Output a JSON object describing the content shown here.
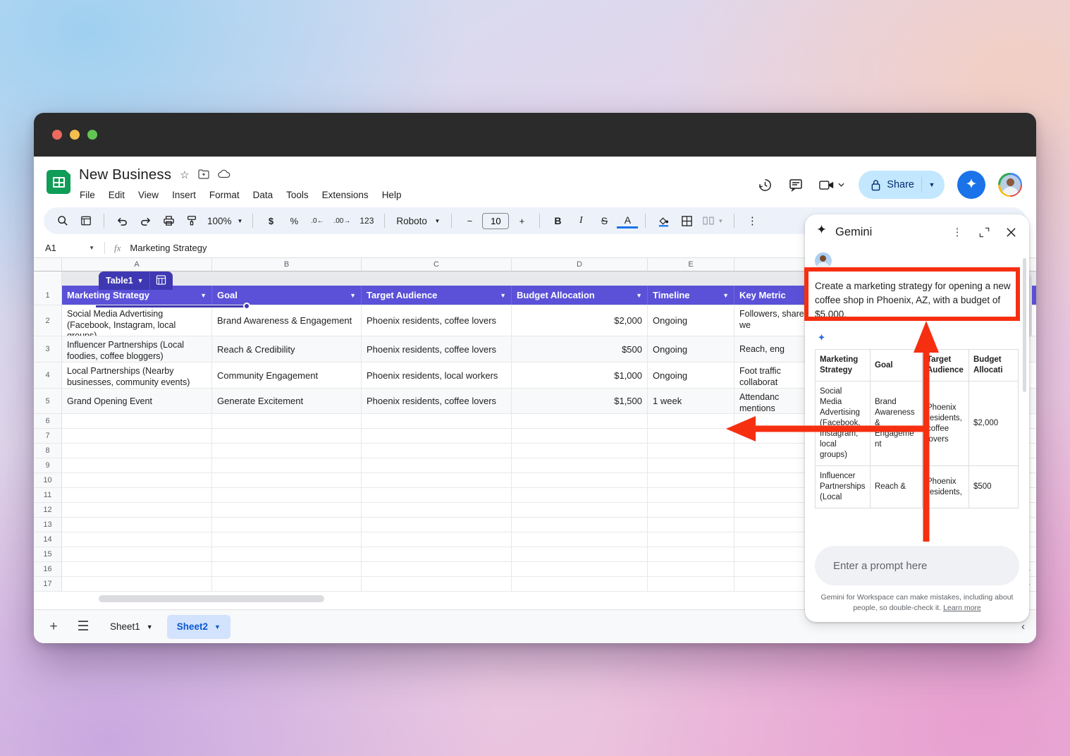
{
  "window": {
    "traffic_lights": [
      "close",
      "minimize",
      "maximize"
    ]
  },
  "header": {
    "doc_title": "New Business",
    "title_icons": [
      "star-icon",
      "move-to-folder-icon",
      "cloud-saved-icon"
    ],
    "menus": [
      "File",
      "Edit",
      "View",
      "Insert",
      "Format",
      "Data",
      "Tools",
      "Extensions",
      "Help"
    ],
    "right_icons": [
      "version-history-icon",
      "comment-icon",
      "meet-icon"
    ],
    "share_label": "Share"
  },
  "toolbar": {
    "zoom": "100%",
    "font": "Roboto",
    "font_size": "10",
    "items": [
      "search-icon",
      "menus-icon",
      "undo-icon",
      "redo-icon",
      "print-icon",
      "paint-format-icon",
      "currency-icon",
      "percent-icon",
      "decrease-decimal-icon",
      "increase-decimal-icon",
      "more-formats-icon",
      "bold-icon",
      "italic-icon",
      "strikethrough-icon",
      "text-color-icon",
      "fill-color-icon",
      "borders-icon",
      "merge-cells-icon",
      "more-icon",
      "collapse-toolbar-icon"
    ]
  },
  "formula_bar": {
    "name_box": "A1",
    "fx": "fx",
    "value": "Marketing Strategy"
  },
  "grid": {
    "column_letters": [
      "A",
      "B",
      "C",
      "D",
      "E"
    ],
    "row_numbers": [
      "1",
      "2",
      "3",
      "4",
      "5",
      "6",
      "7",
      "8",
      "9",
      "10",
      "11",
      "12",
      "13",
      "14",
      "15",
      "16",
      "17"
    ],
    "table_chip": {
      "name": "Table1"
    },
    "headers": [
      "Marketing Strategy",
      "Goal",
      "Target Audience",
      "Budget Allocation",
      "Timeline",
      "Key Metric"
    ],
    "rows": [
      {
        "n": "2",
        "strategy": "Social Media Advertising (Facebook, Instagram, local groups)",
        "goal": "Brand Awareness & Engagement",
        "audience": "Phoenix residents, coffee lovers",
        "budget": "$2,000",
        "timeline": "Ongoing",
        "metric": "Followers, shares, we"
      },
      {
        "n": "3",
        "strategy": "Influencer Partnerships (Local foodies, coffee bloggers)",
        "goal": "Reach & Credibility",
        "audience": "Phoenix residents, coffee lovers",
        "budget": "$500",
        "timeline": "Ongoing",
        "metric": "Reach, eng"
      },
      {
        "n": "4",
        "strategy": "Local Partnerships (Nearby businesses, community events)",
        "goal": "Community Engagement",
        "audience": "Phoenix residents, local workers",
        "budget": "$1,000",
        "timeline": "Ongoing",
        "metric": "Foot traffic collaborat"
      },
      {
        "n": "5",
        "strategy": "Grand Opening Event",
        "goal": "Generate Excitement",
        "audience": "Phoenix residents, coffee lovers",
        "budget": "$1,500",
        "timeline": "1 week",
        "metric": "Attendanc mentions"
      }
    ]
  },
  "sheet_tabs": {
    "add_label": "+",
    "all_sheets_icon": "all-sheets-icon",
    "tabs": [
      {
        "label": "Sheet1",
        "active": false
      },
      {
        "label": "Sheet2",
        "active": true
      }
    ]
  },
  "gemini": {
    "title": "Gemini",
    "header_icons": [
      "more-options-icon",
      "expand-icon",
      "close-icon"
    ],
    "prompt_message": "Create a marketing strategy for opening a new coffee shop in Phoenix, AZ, with a budget of $5,000.",
    "response_table": {
      "headers": [
        "Marketing Strategy",
        "Goal",
        "Target Audience",
        "Budget Allocati"
      ],
      "rows": [
        [
          "Social Media Advertising (Facebook, Instagram, local groups)",
          "Brand Awareness & Engagement",
          "Phoenix residents, coffee lovers",
          "$2,000"
        ],
        [
          "Influencer Partnerships (Local",
          "Reach &",
          "Phoenix residents,",
          "$500"
        ]
      ]
    },
    "input_placeholder": "Enter a prompt here",
    "disclaimer": "Gemini for Workspace can make mistakes, including about people, so double-check it.",
    "disclaimer_link": "Learn more"
  },
  "annotation": {
    "color": "#f62f11",
    "shapes": [
      "prompt-highlight-box",
      "up-arrow",
      "left-arrow"
    ]
  }
}
